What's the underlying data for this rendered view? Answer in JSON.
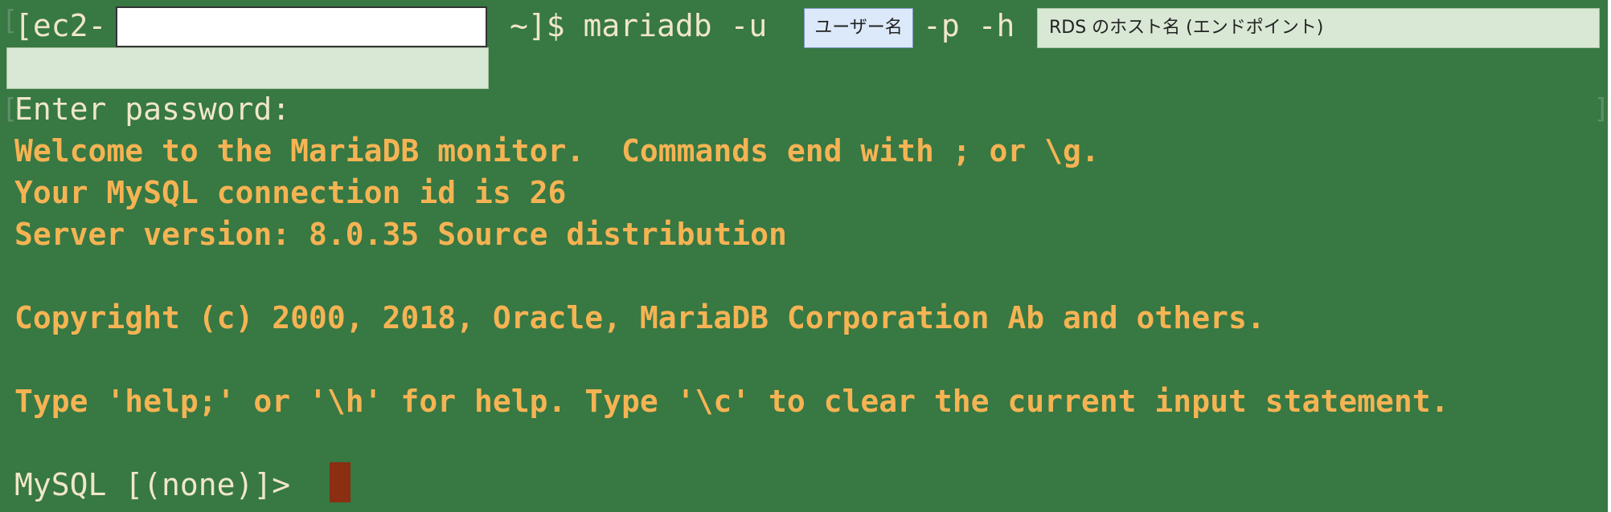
{
  "prompt_line": {
    "open": "[ec2-",
    "middle": "~]$ mariadb -u",
    "p_flag": "-p -h",
    "user_placeholder": "ユーザー名",
    "host_placeholder": "RDS のホスト名 (エンドポイント)"
  },
  "lines": {
    "enter_password": "Enter password:",
    "welcome": "Welcome to the MariaDB monitor.  Commands end with ; or \\g.",
    "connection_id": "Your MySQL connection id is 26",
    "server_version": "Server version: 8.0.35 Source distribution",
    "copyright": "Copyright (c) 2000, 2018, Oracle, MariaDB Corporation Ab and others.",
    "help": "Type 'help;' or '\\h' for help. Type '\\c' to clear the current input statement.",
    "mysql_prompt": "MySQL [(none)]>"
  },
  "colors": {
    "background": "#377843",
    "output_text": "#f6b353",
    "prompt_text": "#f0e6c8",
    "cursor": "#8b2e12",
    "user_box": "#dce9fa",
    "host_box": "#d9e8d5"
  }
}
